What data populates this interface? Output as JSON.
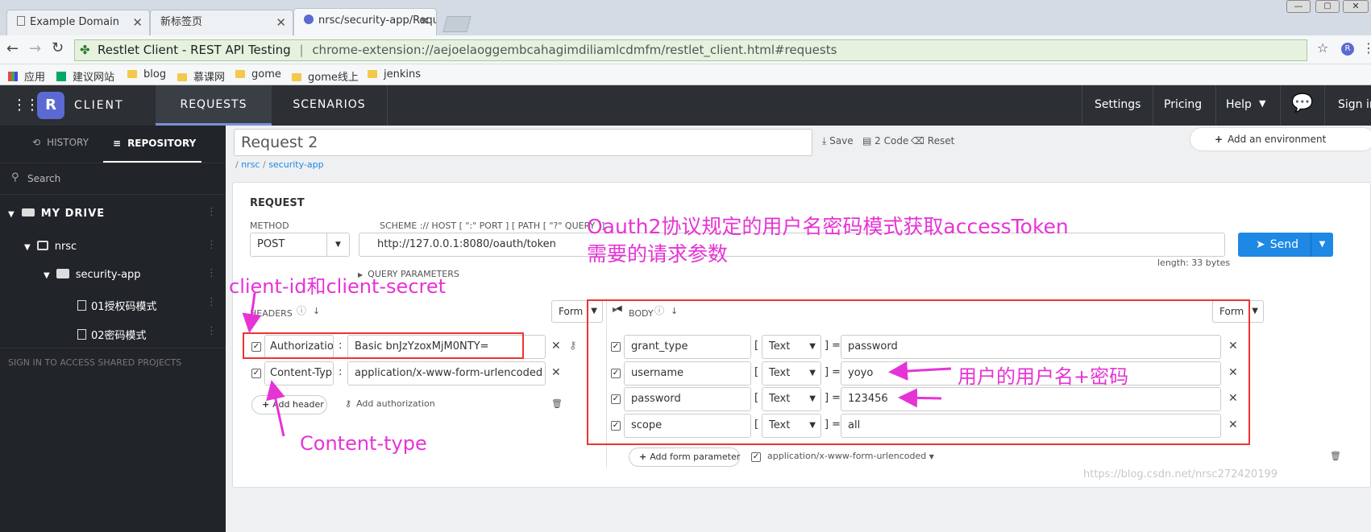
{
  "browser": {
    "tabs": [
      {
        "title": "Example Domain"
      },
      {
        "title": "新标签页"
      },
      {
        "title": "nrsc/security-app/Requ"
      }
    ],
    "site_name": "Restlet Client - REST API Testing",
    "url": "chrome-extension://aejoelaoggembcahagimdiliamlcdmfm/restlet_client.html#requests",
    "bookmarks": [
      "应用",
      "建议网站",
      "blog",
      "慕课网",
      "gome",
      "gome线上",
      "jenkins"
    ]
  },
  "nav": {
    "logo_letter": "R",
    "client_label": "CLIENT",
    "tabs": [
      "REQUESTS",
      "SCENARIOS"
    ],
    "right": [
      "Settings",
      "Pricing",
      "Help",
      "Sign in"
    ]
  },
  "sidebar": {
    "tabs": [
      "HISTORY",
      "REPOSITORY"
    ],
    "search_placeholder": "Search",
    "drive": "MY DRIVE",
    "project": "nrsc",
    "folder": "security-app",
    "requests": [
      "01授权码模式",
      "02密码模式"
    ],
    "sign_in_note": "SIGN IN TO ACCESS SHARED PROJECTS"
  },
  "request": {
    "name": "Request 2",
    "actions": [
      "Save",
      "2 Code",
      "Reset"
    ],
    "add_env": "Add an environment",
    "breadcrumb": [
      "nrsc",
      "security-app"
    ],
    "section": "REQUEST",
    "method_label": "METHOD",
    "method": "POST",
    "scheme_label": "SCHEME :// HOST [ \":\" PORT ] [ PATH [ \"?\" QUERY ]]",
    "url": "http://127.0.0.1:8080/oauth/token",
    "send": "Send",
    "length": "length: 33 bytes",
    "query_params": "QUERY PARAMETERS"
  },
  "headers": {
    "label": "HEADERS",
    "mode": "Form",
    "rows": [
      {
        "key": "Authorizatio",
        "value": "Basic bnJzYzoxMjM0NTY="
      },
      {
        "key": "Content-Typ",
        "value": "application/x-www-form-urlencoded"
      }
    ],
    "add_header": "Add header",
    "add_auth": "Add authorization"
  },
  "body": {
    "label": "BODY",
    "mode": "Form",
    "rows": [
      {
        "key": "grant_type",
        "type": "Text",
        "value": "password"
      },
      {
        "key": "username",
        "type": "Text",
        "value": "yoyo"
      },
      {
        "key": "password",
        "type": "Text",
        "value": "123456"
      },
      {
        "key": "scope",
        "type": "Text",
        "value": "all"
      }
    ],
    "add_param": "Add form parameter",
    "content_type": "application/x-www-form-urlencoded"
  },
  "annotations": {
    "top_line1": "Oauth2协议规定的用户名密码模式获取accessToken",
    "top_line2": "需要的请求参数",
    "client": "client-id和client-secret",
    "content_type": "Content-type",
    "user_pass": "用户的用户名+密码"
  },
  "watermark": "https://blog.csdn.net/nrsc272420199",
  "colors": {
    "accent": "#1e88e5",
    "annotation": "#e633d6",
    "highlight_box": "#e33333"
  }
}
